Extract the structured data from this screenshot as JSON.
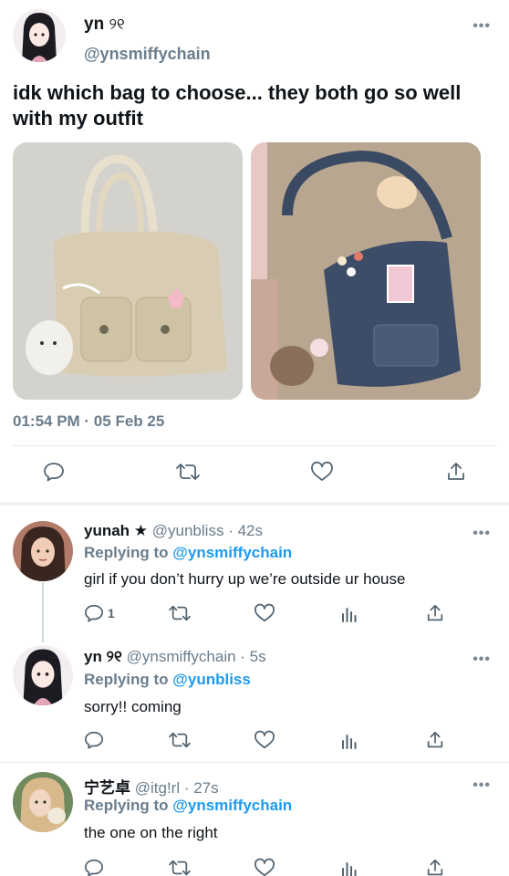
{
  "main": {
    "name": "yn",
    "name_emoji": "୨୧",
    "handle": "@ynsmiffychain",
    "text": "idk which bag to choose... they both go so well with my outfit",
    "timestamp": "01:54 PM · 05 Feb 25",
    "more_label": "•••"
  },
  "replies": [
    {
      "name": "yunah ★",
      "handle": "@yunbliss",
      "time": "· 42s",
      "replying_prefix": "Replying to",
      "replying_to": "@ynsmiffychain",
      "text": "girl if you don’t hurry up we’re outside ur house",
      "reply_count": "1"
    },
    {
      "name": "yn ୨୧",
      "handle": "@ynsmiffychain",
      "time": "· 5s",
      "replying_prefix": "Replying to",
      "replying_to": "@yunbliss",
      "text": "sorry!! coming",
      "reply_count": ""
    },
    {
      "name": "宁艺卓",
      "handle": "@itg!rl",
      "time": "· 27s",
      "replying_prefix": "Replying to",
      "replying_to": "@ynsmiffychain",
      "text": "the one on the right",
      "reply_count": ""
    }
  ],
  "icons": {
    "reply": "reply-icon",
    "retweet": "retweet-icon",
    "like": "heart-icon",
    "analytics": "analytics-icon",
    "share": "share-icon",
    "more": "more-icon"
  },
  "colors": {
    "accent": "#1d9bf0",
    "secondary_text": "#6b7d8c",
    "divider": "#e6ecf0"
  }
}
